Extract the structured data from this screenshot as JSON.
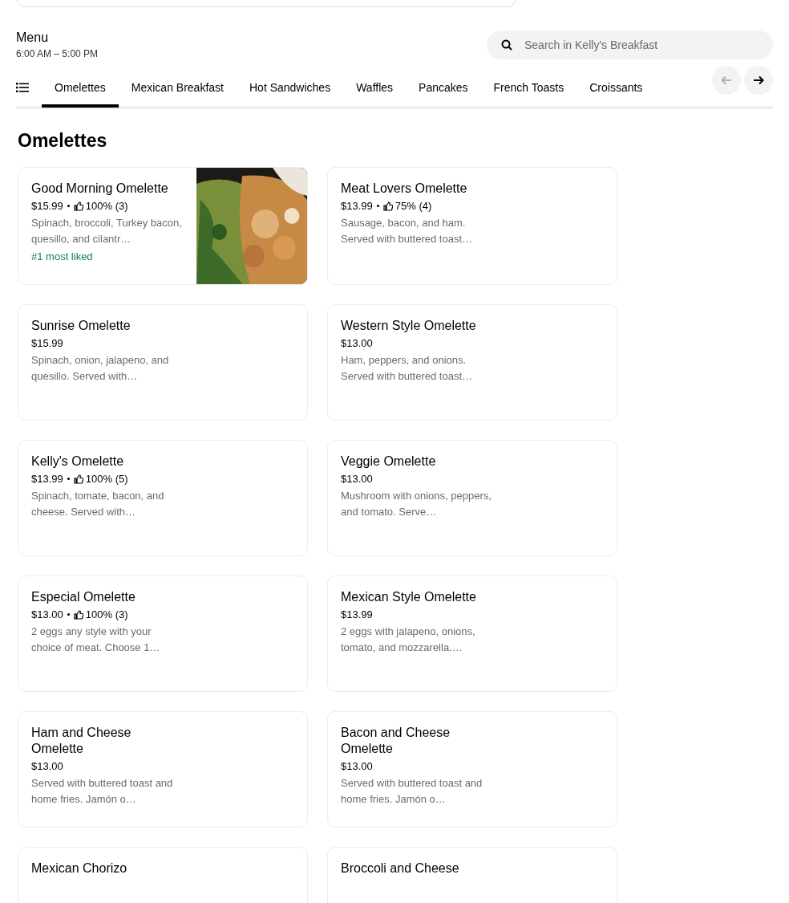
{
  "menu": {
    "title": "Menu",
    "hours": "6:00 AM – 5:00 PM"
  },
  "search": {
    "placeholder": "Search in Kelly's Breakfast"
  },
  "tabs": [
    {
      "label": "Omelettes",
      "selected": true
    },
    {
      "label": "Mexican Breakfast",
      "selected": false
    },
    {
      "label": "Hot Sandwiches",
      "selected": false
    },
    {
      "label": "Waffles",
      "selected": false
    },
    {
      "label": "Pancakes",
      "selected": false
    },
    {
      "label": "French Toasts",
      "selected": false
    },
    {
      "label": "Croissants",
      "selected": false
    }
  ],
  "scroll_buttons": [
    {
      "kind": "back",
      "disabled": true
    },
    {
      "kind": "forward",
      "disabled": false
    }
  ],
  "section": {
    "title": "Omelettes"
  },
  "items": [
    {
      "name": "Good Morning Omelette",
      "price": "$15.99",
      "rating": "100% (3)",
      "description": "Spinach, broccoli, Turkey bacon, quesillo, and cilantr…",
      "badge": "#1 most liked"
    },
    {
      "name": "Meat Lovers Omelette",
      "price": "$13.99",
      "rating": "75% (4)",
      "description": "Sausage, bacon, and ham. Served with buttered toast…"
    },
    {
      "name": "Sunrise Omelette",
      "price": "$15.99",
      "description": "Spinach, onion, jalapeno, and quesillo. Served with…"
    },
    {
      "name": "Western Style Omelette",
      "price": "$13.00",
      "description": "Ham, peppers, and onions. Served with buttered toast…"
    },
    {
      "name": "Kelly's Omelette",
      "price": "$13.99",
      "rating": "100% (5)",
      "description": "Spinach, tomate, bacon, and cheese. Served with…"
    },
    {
      "name": "Veggie Omelette",
      "price": "$13.00",
      "description": "Mushroom with onions, peppers, and tomato. Serve…"
    },
    {
      "name": "Especial Omelette",
      "price": "$13.00",
      "rating": "100% (3)",
      "description": "2 eggs any style with your choice of meat. Choose 1…"
    },
    {
      "name": "Mexican Style Omelette",
      "price": "$13.99",
      "description": "2 eggs with jalapeno, onions, tomato, and mozzarella.…"
    },
    {
      "name": "Ham and Cheese Omelette",
      "price": "$13.00",
      "description": "Served with buttered toast and home fries. Jamón o…"
    },
    {
      "name": "Bacon and Cheese Omelette",
      "price": "$13.00",
      "description": "Served with buttered toast and home fries. Jamón o…"
    },
    {
      "name": "Mexican Chorizo"
    },
    {
      "name": "Broccoli and Cheese"
    }
  ]
}
